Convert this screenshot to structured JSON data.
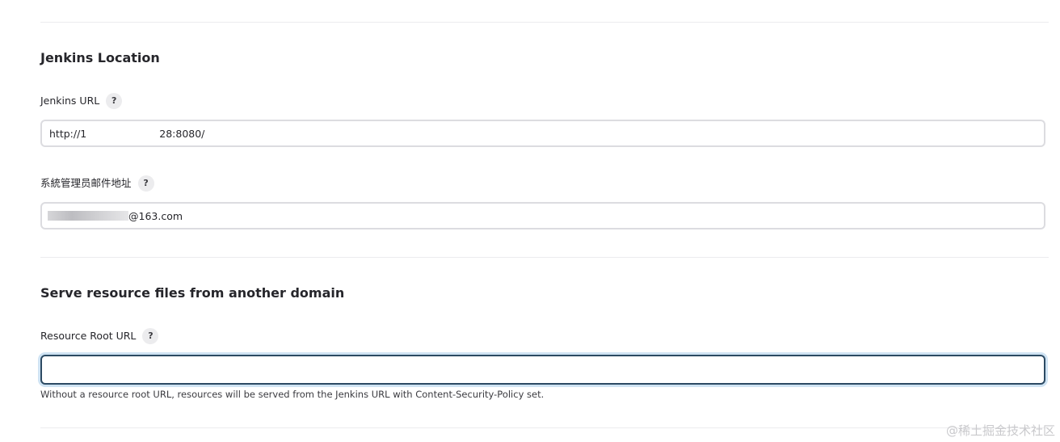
{
  "jenkins_location": {
    "title": "Jenkins Location",
    "url_label": "Jenkins URL",
    "url_value_start": "http://1",
    "url_value_end": "28:8080/",
    "email_label": "系統管理员邮件地址",
    "email_value_end": "@163.com"
  },
  "resource": {
    "title": "Serve resource files from another domain",
    "root_url_label": "Resource Root URL",
    "root_url_value": "",
    "hint": "Without a resource root URL, resources will be served from the Jenkins URL with Content-Security-Policy set."
  },
  "help_glyph": "?",
  "watermark": "@稀土掘金技术社区",
  "colors": {
    "focus_border": "#2c4a63",
    "focus_ring": "#cfe3f3",
    "help_bg": "#ececee"
  }
}
